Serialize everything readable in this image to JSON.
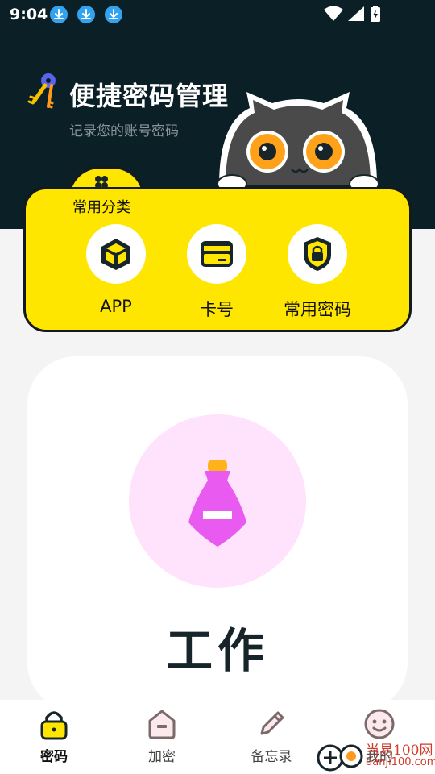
{
  "status_bar": {
    "time": "9:04",
    "icons": [
      "download-icon",
      "download-icon",
      "download-icon",
      "wifi-icon",
      "signal-icon",
      "battery-icon"
    ]
  },
  "header": {
    "title": "便捷密码管理",
    "subtitle": "记录您的账号密码",
    "colors": {
      "background": "#0b1f26"
    }
  },
  "categories": {
    "title": "常用分类",
    "items": [
      {
        "label": "APP",
        "icon": "cube-icon"
      },
      {
        "label": "卡号",
        "icon": "card-icon"
      },
      {
        "label": "常用密码",
        "icon": "shield-lock-icon"
      }
    ],
    "colors": {
      "card": "#ffe600",
      "border": "#121a1d"
    }
  },
  "main_card": {
    "title": "工作",
    "icon": "tag-icon",
    "colors": {
      "circle": "#ffe2fb",
      "tag": "#e85af0"
    }
  },
  "bottom_nav": {
    "items": [
      {
        "label": "密码",
        "icon": "lock-icon",
        "active": true
      },
      {
        "label": "加密",
        "icon": "house-icon",
        "active": false
      },
      {
        "label": "备忘录",
        "icon": "pencil-icon",
        "active": false
      },
      {
        "label": "我的",
        "icon": "smiley-icon",
        "active": false
      }
    ]
  },
  "watermark": {
    "line1": "当易100网",
    "line2": "danji100.com"
  }
}
